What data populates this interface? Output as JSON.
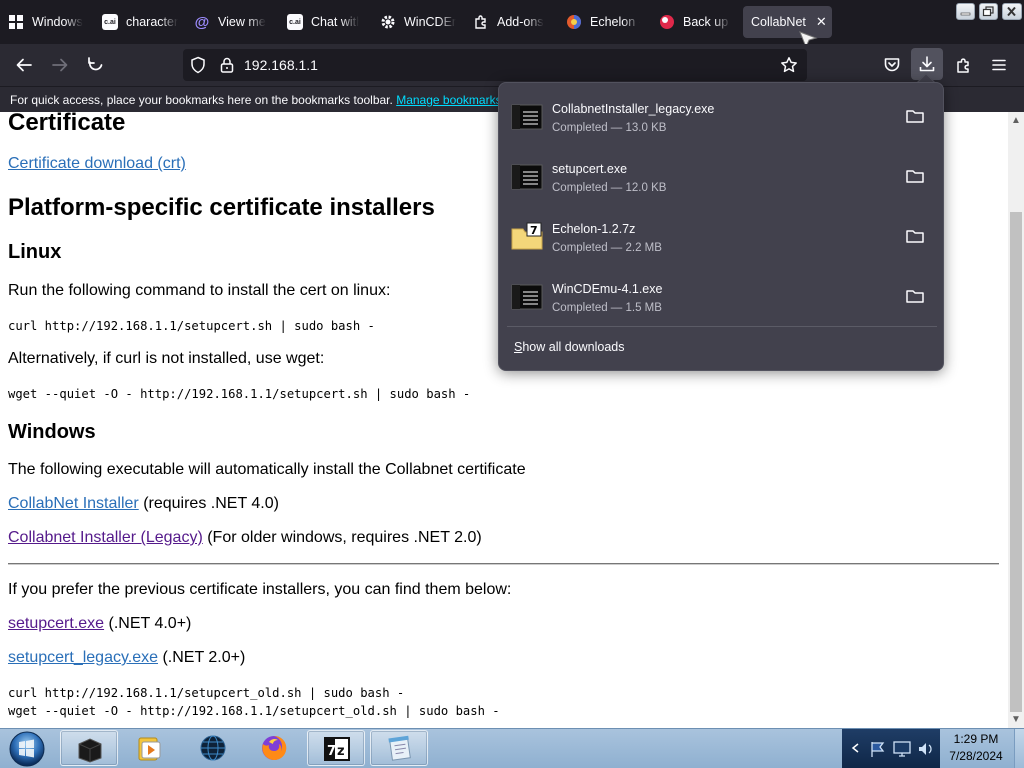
{
  "tabs": [
    {
      "label": "Windows",
      "icon": "windows-icon"
    },
    {
      "label": "character",
      "icon": "cai-icon"
    },
    {
      "label": "View me",
      "icon": "at-sign-icon"
    },
    {
      "label": "Chat with",
      "icon": "cai-icon"
    },
    {
      "label": "WinCDEm",
      "icon": "gear-icon"
    },
    {
      "label": "Add-ons",
      "icon": "puzzle-icon"
    },
    {
      "label": "Echelon -",
      "icon": "echelon-icon"
    },
    {
      "label": "Back up a",
      "icon": "backup-icon"
    },
    {
      "label": "CollabNet",
      "icon": "none",
      "active": true
    }
  ],
  "navbar": {
    "url": "192.168.1.1"
  },
  "bookmarks_bar": {
    "message": "For quick access, place your bookmarks here on the bookmarks toolbar.",
    "link": "Manage bookmarks..."
  },
  "page": {
    "certificate_heading": "Certificate",
    "certificate_download": "Certificate download (crt)",
    "platform_heading": "Platform-specific certificate installers",
    "linux_heading": "Linux",
    "linux_text": "Run the following command to install the cert on linux:",
    "linux_cmd": "curl http://192.168.1.1/setupcert.sh | sudo bash -",
    "alt_text": "Alternatively, if curl is not installed, use wget:",
    "wget_cmd": "wget --quiet -O - http://192.168.1.1/setupcert.sh | sudo bash -",
    "windows_heading": "Windows",
    "windows_text": "The following executable will automatically install the Collabnet certificate",
    "installer_link": "CollabNet Installer",
    "installer_note": "(requires .NET 4.0)",
    "installer_legacy_link": "Collabnet Installer (Legacy)",
    "installer_legacy_note": "(For older windows, requires .NET 2.0)",
    "previous_text": "If you prefer the previous certificate installers, you can find them below:",
    "setupcert_link": "setupcert.exe",
    "setupcert_note": "(.NET 4.0+)",
    "setupcert_legacy_link": "setupcert_legacy.exe",
    "setupcert_legacy_note": "(.NET 2.0+)",
    "old_curl_cmd": "curl http://192.168.1.1/setupcert_old.sh | sudo bash -",
    "old_wget_cmd": "wget --quiet -O - http://192.168.1.1/setupcert_old.sh | sudo bash -"
  },
  "downloads": {
    "items": [
      {
        "name": "CollabnetInstaller_legacy.exe",
        "status": "Completed — 13.0 KB",
        "icon": "exe-file-icon"
      },
      {
        "name": "setupcert.exe",
        "status": "Completed — 12.0 KB",
        "icon": "exe-file-icon"
      },
      {
        "name": "Echelon-1.2.7z",
        "status": "Completed — 2.2 MB",
        "icon": "7z-file-icon"
      },
      {
        "name": "WinCDEmu-4.1.exe",
        "status": "Completed — 1.5 MB",
        "icon": "exe-file-icon"
      }
    ],
    "show_all_prefix": "S",
    "show_all_rest": "how all downloads"
  },
  "taskbar": {
    "apps": [
      "terminal-app",
      "media-player-app",
      "browser-globe-app",
      "firefox-app",
      "7zip-app",
      "notepad-app"
    ],
    "time": "1:29 PM",
    "date": "7/28/2024"
  },
  "colors": {
    "tabstrip": "#1c1b22",
    "toolbar": "#2b2a33",
    "panel": "#42414d",
    "link_accent": "#00ddff"
  }
}
